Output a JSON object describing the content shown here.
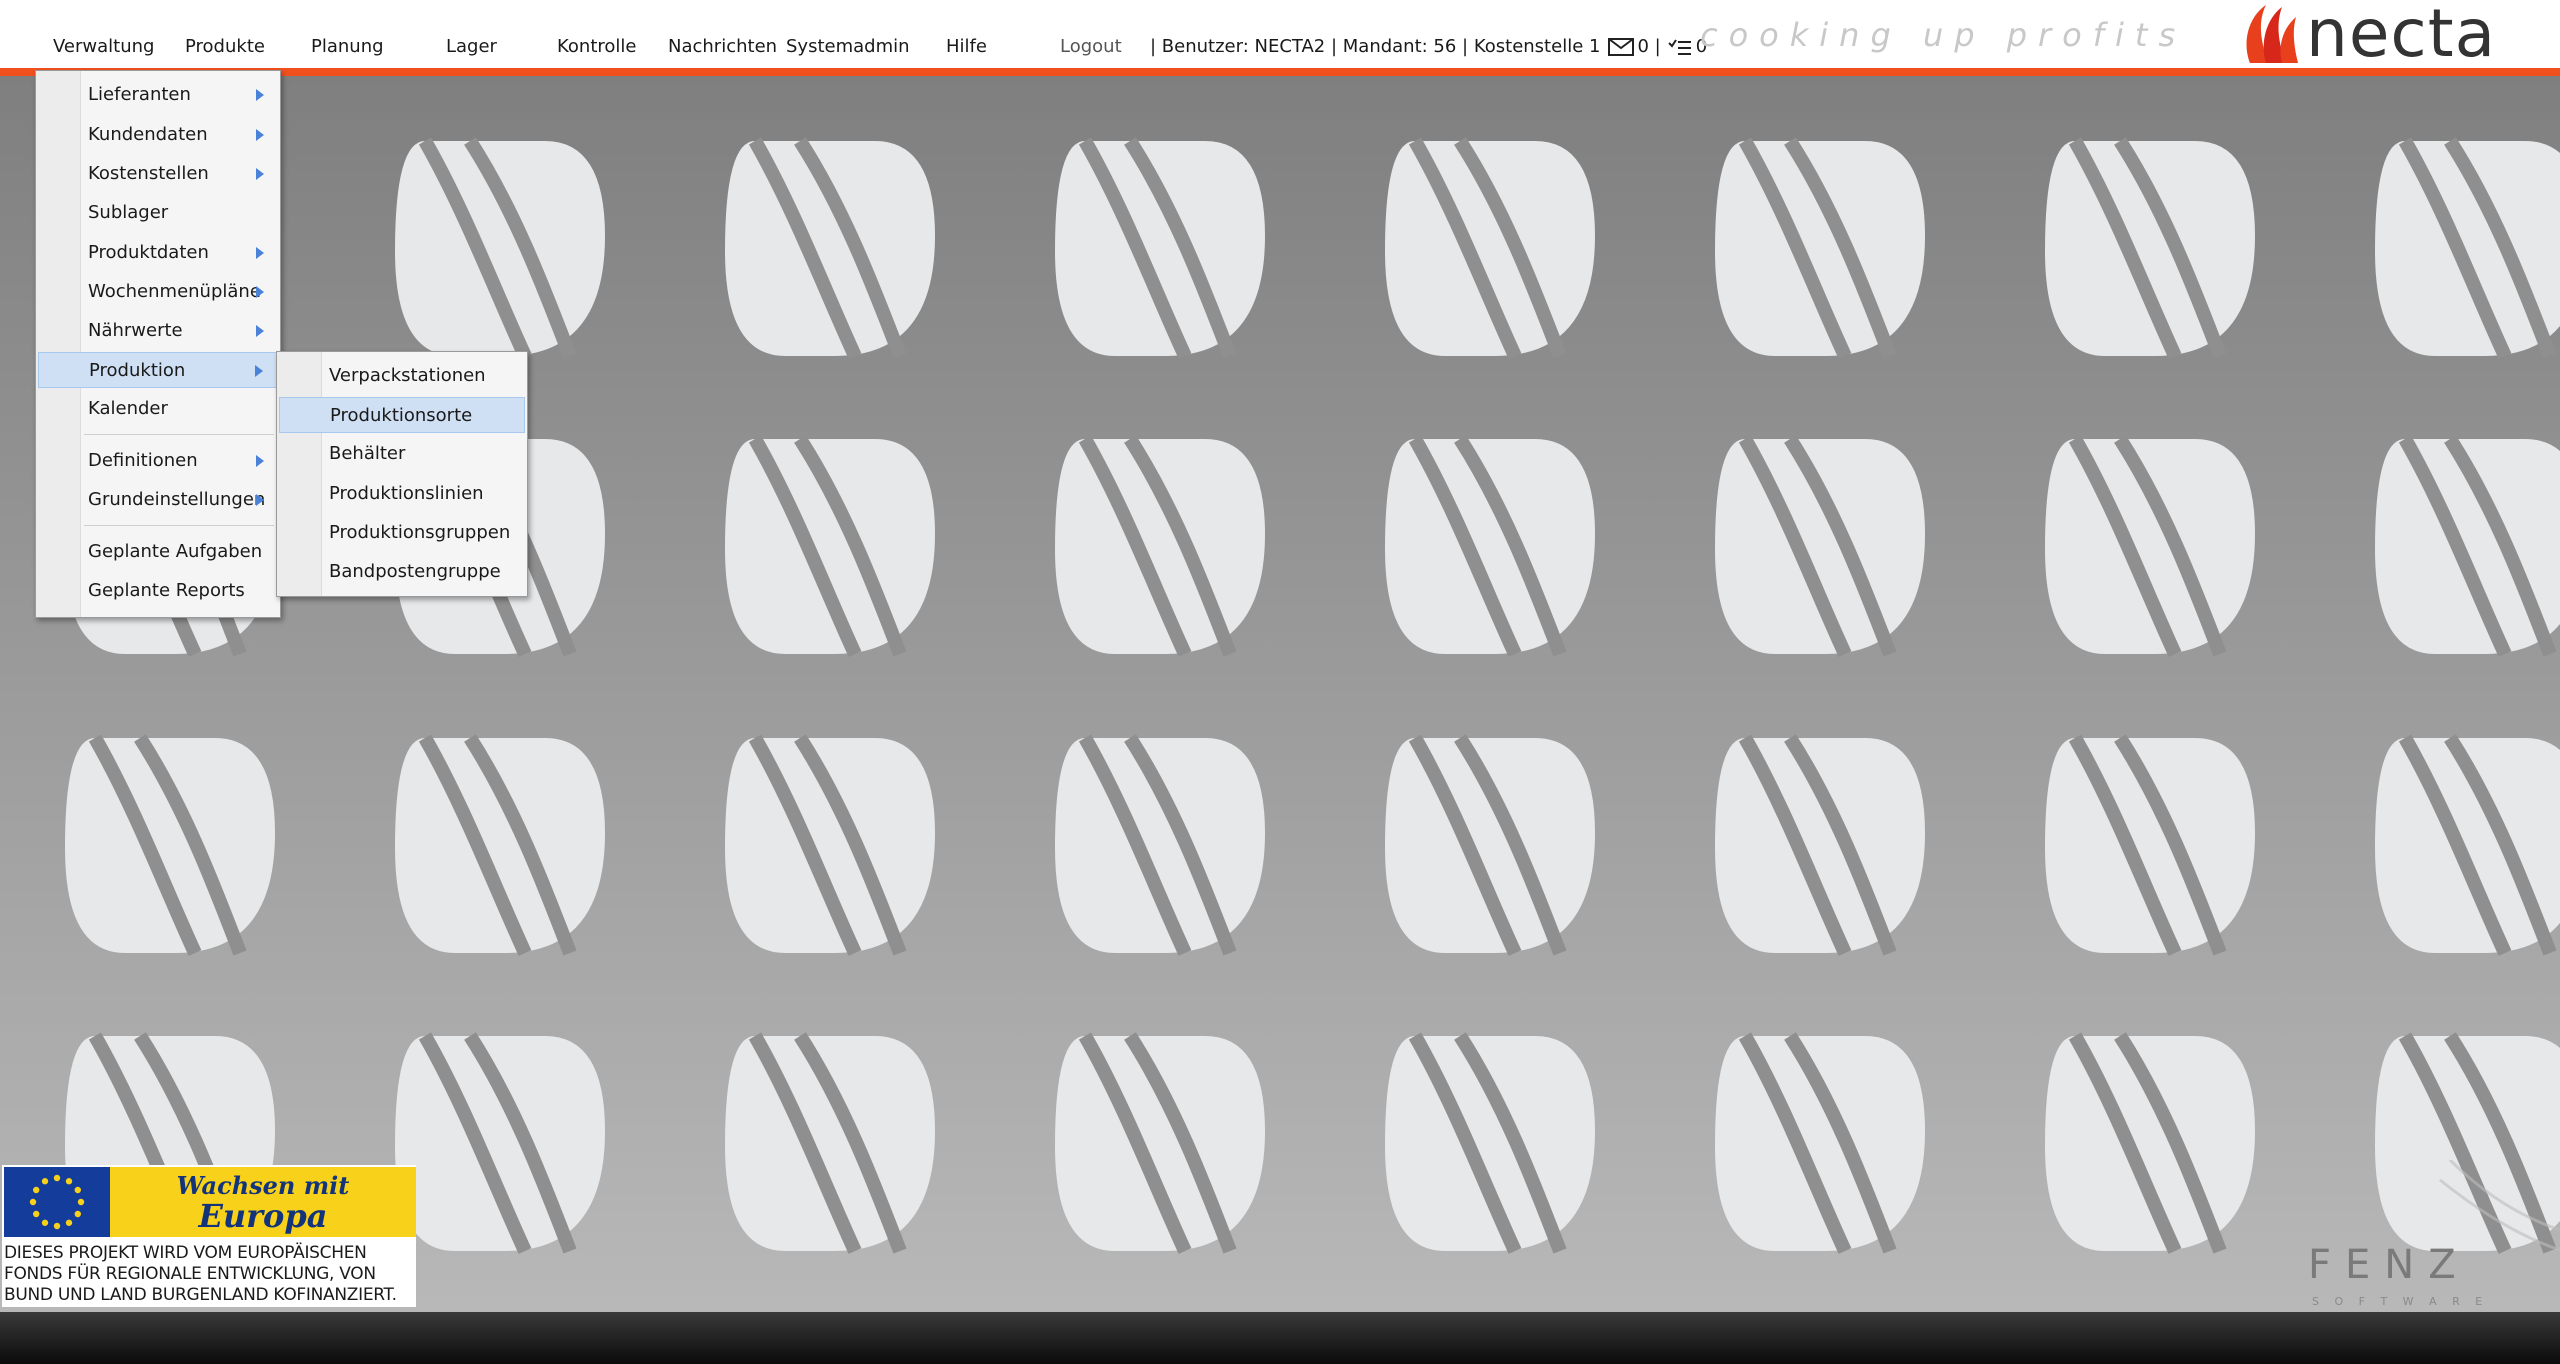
{
  "nav": {
    "items": [
      "Verwaltung",
      "Produkte",
      "Planung",
      "Lager",
      "Kontrolle",
      "Nachrichten",
      "Systemadmin",
      "Hilfe"
    ],
    "logout": "Logout"
  },
  "status": {
    "user": "| Benutzer: NECTA2 | Mandant: 56 | Kostenstelle 1",
    "messages": "0 |",
    "tasks": "0"
  },
  "brand": {
    "tagline": "cooking up profits",
    "name": "necta",
    "accent": "#f0501e"
  },
  "menu": {
    "items": [
      {
        "label": "Lieferanten",
        "submenu": true
      },
      {
        "label": "Kundendaten",
        "submenu": true
      },
      {
        "label": "Kostenstellen",
        "submenu": true
      },
      {
        "label": "Sublager",
        "submenu": false
      },
      {
        "label": "Produktdaten",
        "submenu": true
      },
      {
        "label": "Wochenmenüpläne",
        "submenu": true
      },
      {
        "label": "Nährwerte",
        "submenu": true
      },
      {
        "label": "Produktion",
        "submenu": true,
        "active": true
      },
      {
        "label": "Kalender",
        "submenu": false
      },
      {
        "label": "Definitionen",
        "submenu": true
      },
      {
        "label": "Grundeinstellungen",
        "submenu": true
      },
      {
        "label": "Geplante Aufgaben",
        "submenu": false
      },
      {
        "label": "Geplante Reports",
        "submenu": false
      }
    ]
  },
  "submenu": {
    "items": [
      {
        "label": "Verpackstationen"
      },
      {
        "label": "Produktionsorte",
        "hover": true
      },
      {
        "label": "Behälter"
      },
      {
        "label": "Produktionslinien"
      },
      {
        "label": "Produktionsgruppen"
      },
      {
        "label": "Bandpostengruppe"
      }
    ]
  },
  "eu_logo": {
    "line1": "Wachsen mit",
    "line2": "Europa",
    "text": [
      "DIESES PROJEKT WIRD  VOM EUROPÄISCHEN",
      "FONDS FÜR REGIONALE ENTWICKLUNG,  VON",
      "BUND UND LAND BURGENLAND KOFINANZIERT."
    ]
  },
  "fenz_logo": {
    "name": "FENZ",
    "sub": "S O F T W A R E"
  }
}
